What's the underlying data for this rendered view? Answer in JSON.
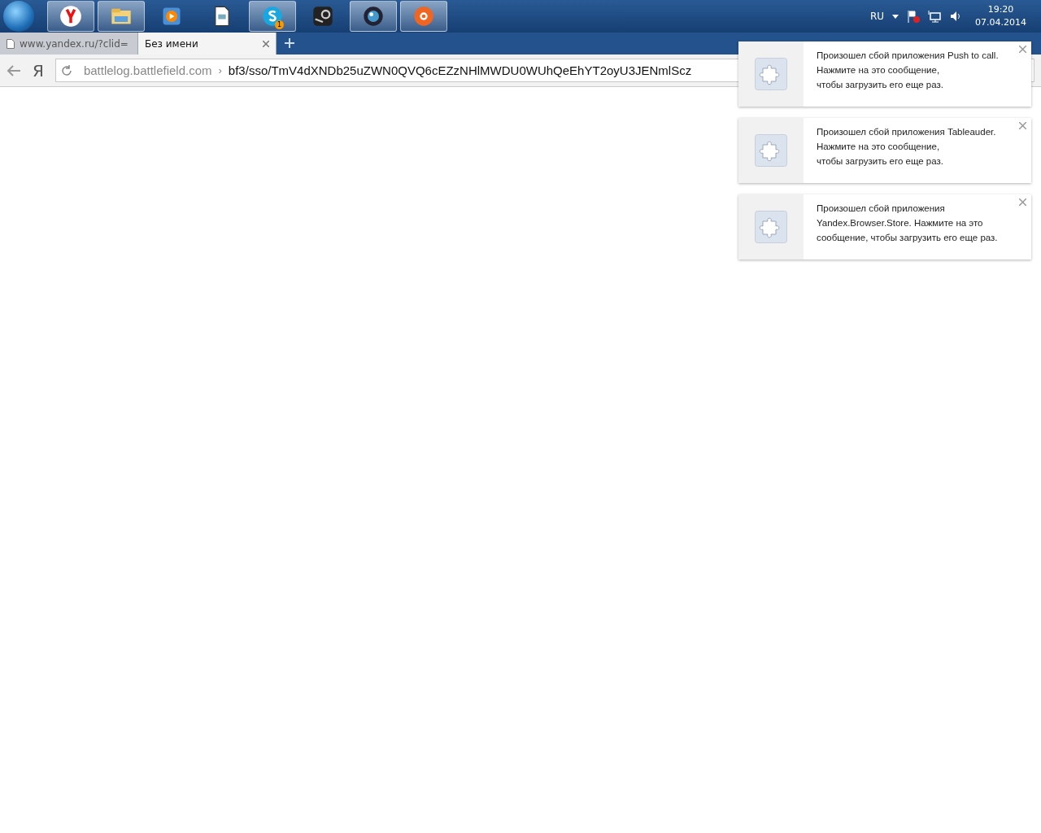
{
  "taskbar": {
    "apps": [
      {
        "kind": "yandex",
        "active": true
      },
      {
        "kind": "explorer",
        "active": true
      },
      {
        "kind": "media",
        "active": false
      },
      {
        "kind": "document",
        "active": false
      },
      {
        "kind": "skype",
        "active": true,
        "badge": "1"
      },
      {
        "kind": "steam",
        "active": false
      },
      {
        "kind": "cinema",
        "active": true
      },
      {
        "kind": "origin",
        "active": true
      }
    ],
    "language": "RU",
    "time": "19:20",
    "date": "07.04.2014"
  },
  "tabs": [
    {
      "title": "www.yandex.ru/?clid=",
      "selected": false
    },
    {
      "title": "Без имени",
      "selected": true
    }
  ],
  "address_bar": {
    "logo": "Я",
    "host": "battlelog.battlefield.com",
    "separator": "›",
    "path": "bf3/sso/TmV4dXNDb25uZWN0QVQ6cEZzNHlMWDU0WUhQeEhYT2oyU3JENmlScz"
  },
  "notifications": [
    {
      "lines": [
        "Произошел сбой приложения Push to call.",
        "Нажмите на это сообщение,",
        "чтобы загрузить его еще раз."
      ]
    },
    {
      "lines": [
        "Произошел сбой приложения Tableauder.",
        "Нажмите на это сообщение,",
        "чтобы загрузить его еще раз."
      ]
    },
    {
      "lines": [
        "Произошел сбой приложения",
        "Yandex.Browser.Store. Нажмите на это",
        "сообщение, чтобы загрузить его еще раз."
      ]
    }
  ]
}
